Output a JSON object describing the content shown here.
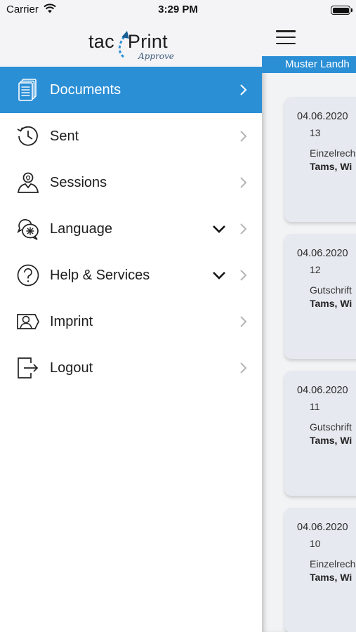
{
  "status_bar": {
    "carrier": "Carrier",
    "time": "3:29 PM"
  },
  "logo": {
    "brand_left": "tac",
    "brand_right": "Print",
    "product": "Approve"
  },
  "menu": {
    "items": [
      {
        "label": "Documents",
        "icon": "documents-icon",
        "active": true
      },
      {
        "label": "Sent",
        "icon": "sent-history-icon"
      },
      {
        "label": "Sessions",
        "icon": "sessions-icon"
      },
      {
        "label": "Language",
        "icon": "language-icon",
        "expandable": true
      },
      {
        "label": "Help & Services",
        "icon": "help-icon",
        "expandable": true
      },
      {
        "label": "Imprint",
        "icon": "imprint-icon"
      },
      {
        "label": "Logout",
        "icon": "logout-icon"
      }
    ]
  },
  "main": {
    "company": "Muster Landh",
    "documents": [
      {
        "date": "04.06.2020",
        "number": "13",
        "type": "Einzelrech",
        "name": "Tams, Wi"
      },
      {
        "date": "04.06.2020",
        "number": "12",
        "type": "Gutschrift",
        "name": "Tams, Wi"
      },
      {
        "date": "04.06.2020",
        "number": "11",
        "type": "Gutschrift",
        "name": "Tams, Wi"
      },
      {
        "date": "04.06.2020",
        "number": "10",
        "type": "Einzelrech",
        "name": "Tams, Wi"
      }
    ]
  },
  "colors": {
    "accent": "#2b8fd6",
    "header_bg": "#f4f4f6",
    "card_bg": "#e6e9ef"
  }
}
